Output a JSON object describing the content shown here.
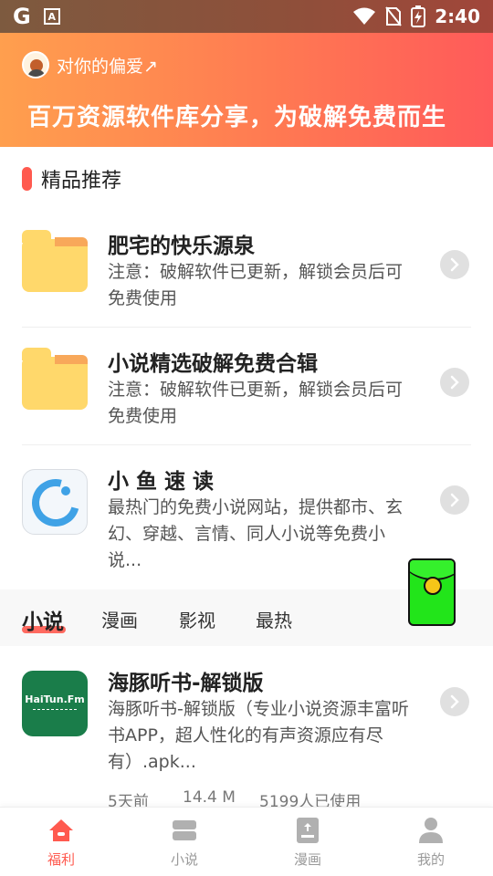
{
  "status_bar": {
    "g_icon": "google-g-icon",
    "a_icon": "app-a-icon",
    "time": "2:40",
    "icons": [
      "wifi-icon",
      "no-sim-icon",
      "battery-charging-icon"
    ]
  },
  "header": {
    "username": "对你的偏爱↗",
    "slogan": "百万资源软件库分享，为破解免费而生",
    "colors": {
      "start": "#ff9f4e",
      "end": "#ff5a5a"
    }
  },
  "section": {
    "title": "精品推荐"
  },
  "recommended": [
    {
      "title": "肥宅的快乐源泉",
      "desc": "注意：破解软件已更新，解锁会员后可免费使用",
      "icon": "folder-icon"
    },
    {
      "title": "小说精选破解免费合辑",
      "desc": "注意：破解软件已更新，解锁会员后可免费使用",
      "icon": "folder-icon"
    },
    {
      "title": "小 鱼 速 读",
      "desc": "最热门的免费小说网站，提供都市、玄幻、穿越、言情、同人小说等免费小说...",
      "icon": "fish-reader-app-icon"
    }
  ],
  "tabs": [
    {
      "label": "小说",
      "active": true
    },
    {
      "label": "漫画",
      "active": false
    },
    {
      "label": "影视",
      "active": false
    },
    {
      "label": "最热",
      "active": false
    }
  ],
  "app_item": {
    "icon_text": "HaiTun.Fm",
    "title": "海豚听书-解锁版",
    "desc": "海豚听书-解锁版（专业小说资源丰富听书APP，超人性化的有声资源应有尽有）.apk...",
    "time": "5天前",
    "size": "14.4 M",
    "users": "5199人已使用"
  },
  "floating": {
    "icon": "red-envelope-icon"
  },
  "bottom_nav": [
    {
      "label": "福利",
      "icon": "home-icon",
      "active": true
    },
    {
      "label": "小说",
      "icon": "book-stack-icon",
      "active": false
    },
    {
      "label": "漫画",
      "icon": "comic-book-icon",
      "active": false
    },
    {
      "label": "我的",
      "icon": "user-icon",
      "active": false
    }
  ],
  "accent_color": "#ff5a4f"
}
